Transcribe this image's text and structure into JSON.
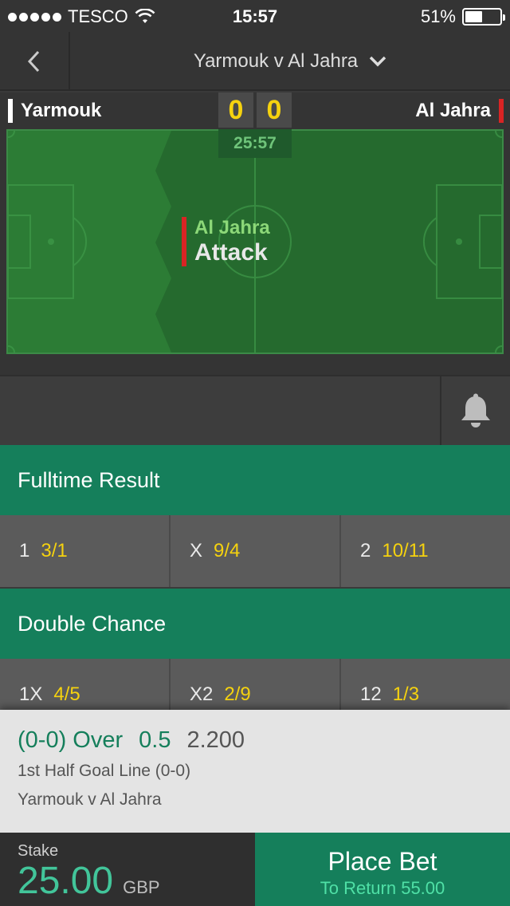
{
  "status_bar": {
    "carrier": "TESCO",
    "time": "15:57",
    "battery_percent": "51%",
    "battery_level": 0.51
  },
  "nav": {
    "back_icon": "chevron-left-icon",
    "title": "Yarmouk v Al Jahra",
    "dropdown_icon": "chevron-down-icon"
  },
  "match": {
    "home_team": "Yarmouk",
    "away_team": "Al Jahra",
    "home_score": "0",
    "away_score": "0",
    "clock": "25:57",
    "home_color": "#ffffff",
    "away_color": "#d92424",
    "event_team": "Al Jahra",
    "event_action": "Attack"
  },
  "notifications": {
    "icon": "bell-icon"
  },
  "markets": [
    {
      "title": "Fulltime Result",
      "odds": [
        {
          "label": "1",
          "value": "3/1"
        },
        {
          "label": "X",
          "value": "9/4"
        },
        {
          "label": "2",
          "value": "10/11"
        }
      ]
    },
    {
      "title": "Double Chance",
      "odds": [
        {
          "label": "1X",
          "value": "4/5"
        },
        {
          "label": "X2",
          "value": "2/9"
        },
        {
          "label": "12",
          "value": "1/3"
        }
      ]
    }
  ],
  "betslip": {
    "selection": "(0-0) Over",
    "line": "0.5",
    "price": "2.200",
    "market": "1st Half Goal Line (0-0)",
    "event": "Yarmouk v Al Jahra"
  },
  "stake": {
    "label": "Stake",
    "amount": "25.00",
    "currency": "GBP"
  },
  "place_bet": {
    "label": "Place Bet",
    "returns": "To Return 55.00"
  },
  "colors": {
    "brand_green": "#157f5b",
    "odds_yellow": "#f5d20f",
    "pitch_green": "#2b7a34"
  }
}
